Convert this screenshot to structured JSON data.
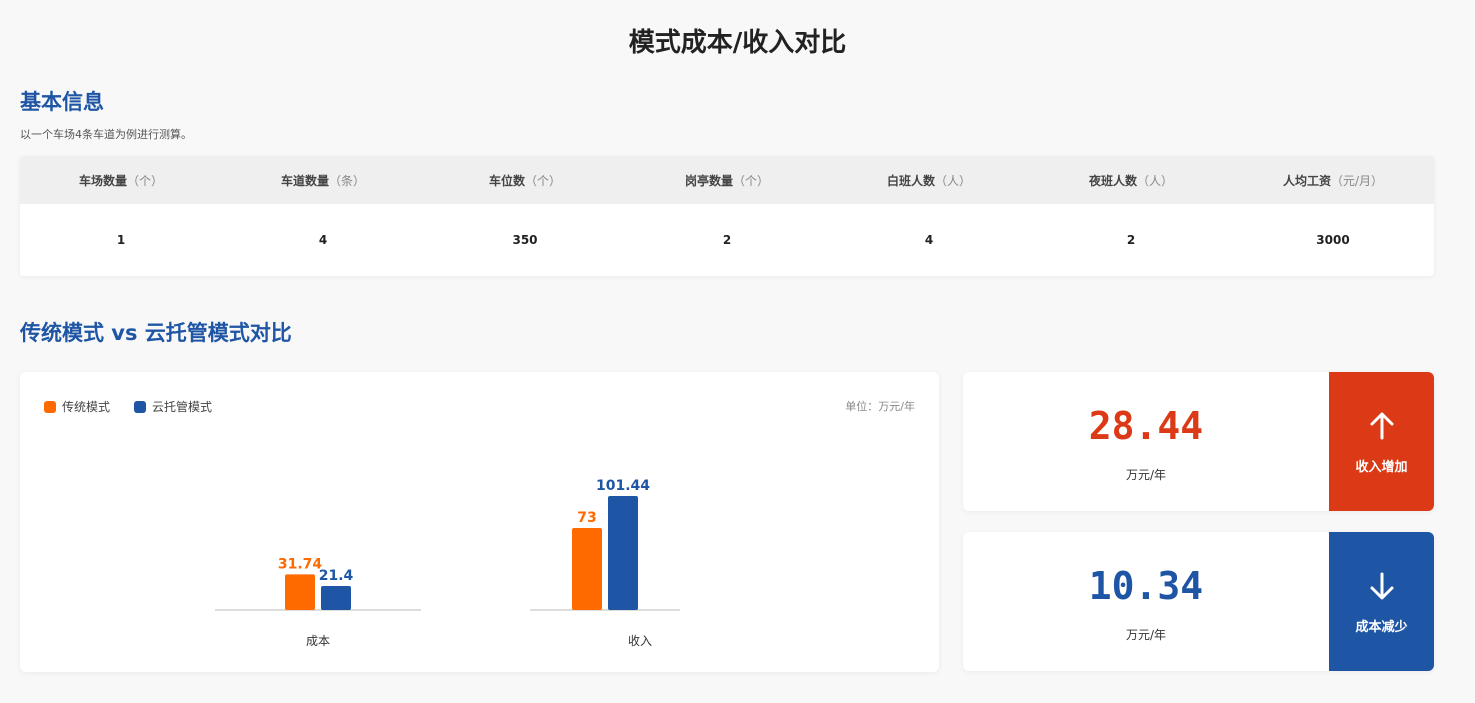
{
  "page_title": "模式成本/收入对比",
  "basic": {
    "title": "基本信息",
    "note": "以一个车场4条车道为例进行测算。",
    "columns": [
      {
        "name": "车场数量",
        "unit": "（个）",
        "value": "1"
      },
      {
        "name": "车道数量",
        "unit": "（条）",
        "value": "4"
      },
      {
        "name": "车位数",
        "unit": "（个）",
        "value": "350"
      },
      {
        "name": "岗亭数量",
        "unit": "（个）",
        "value": "2"
      },
      {
        "name": "白班人数",
        "unit": "（人）",
        "value": "4"
      },
      {
        "name": "夜班人数",
        "unit": "（人）",
        "value": "2"
      },
      {
        "name": "人均工资",
        "unit": "（元/月）",
        "value": "3000"
      }
    ]
  },
  "compare": {
    "title": "传统模式 vs 云托管模式对比",
    "unit_label": "单位：万元/年"
  },
  "colors": {
    "orange": "#ff6a00",
    "blue": "#1f55a5",
    "red": "#dc3a16"
  },
  "chart_data": {
    "type": "bar",
    "categories": [
      "成本",
      "收入"
    ],
    "series": [
      {
        "name": "传统模式",
        "values": [
          31.74,
          73
        ],
        "color": "#ff6a00"
      },
      {
        "name": "云托管模式",
        "values": [
          21.4,
          101.44
        ],
        "color": "#1f55a5"
      }
    ],
    "legend_position": "top-left",
    "grid": false
  },
  "stats": [
    {
      "value": "28.44",
      "unit": "万元/年",
      "label": "收入增加",
      "direction": "up",
      "color": "#dc3a16",
      "icon": "arrow-up-icon"
    },
    {
      "value": "10.34",
      "unit": "万元/年",
      "label": "成本减少",
      "direction": "down",
      "color": "#1f55a5",
      "icon": "arrow-down-icon"
    }
  ]
}
